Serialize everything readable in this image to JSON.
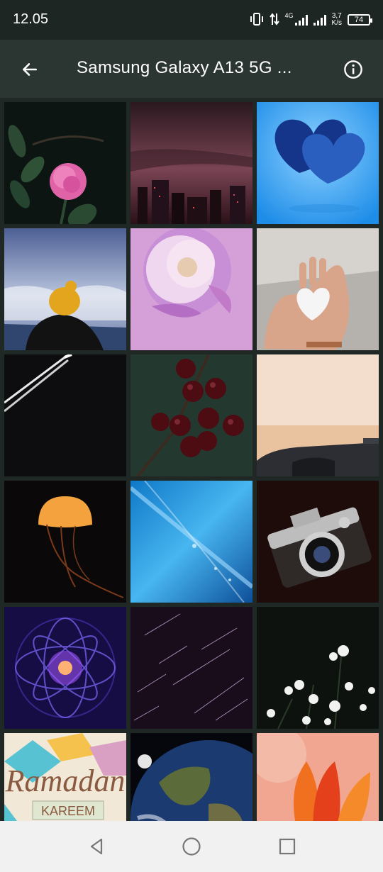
{
  "status_bar": {
    "time": "12.05",
    "network_type": "4G",
    "speed_value": "3,7",
    "speed_unit": "K/s",
    "battery": "74"
  },
  "app_bar": {
    "back_icon": "arrow-left-icon",
    "title": "Samsung Galaxy A13 5G ...",
    "info_icon": "info-icon"
  },
  "wallpapers": [
    {
      "name": "pink-rose"
    },
    {
      "name": "city-skyline-dusk"
    },
    {
      "name": "blue-knitted-hearts"
    },
    {
      "name": "person-yellow-beanie"
    },
    {
      "name": "pink-peony"
    },
    {
      "name": "snow-heart-hand"
    },
    {
      "name": "dark-diagonal-lines"
    },
    {
      "name": "dark-cherries"
    },
    {
      "name": "car-sunset"
    },
    {
      "name": "orange-jellyfish"
    },
    {
      "name": "blue-feather"
    },
    {
      "name": "vintage-camera"
    },
    {
      "name": "purple-fractal"
    },
    {
      "name": "star-trails"
    },
    {
      "name": "white-flowers-dark"
    },
    {
      "name": "ramadan-kareem",
      "text_main": "Ramadan",
      "text_sub": "KAREEM"
    },
    {
      "name": "earth-from-space"
    },
    {
      "name": "red-tulip"
    }
  ],
  "nav_bar": {
    "back": "triangle-back-icon",
    "home": "circle-home-icon",
    "recents": "square-recents-icon"
  }
}
